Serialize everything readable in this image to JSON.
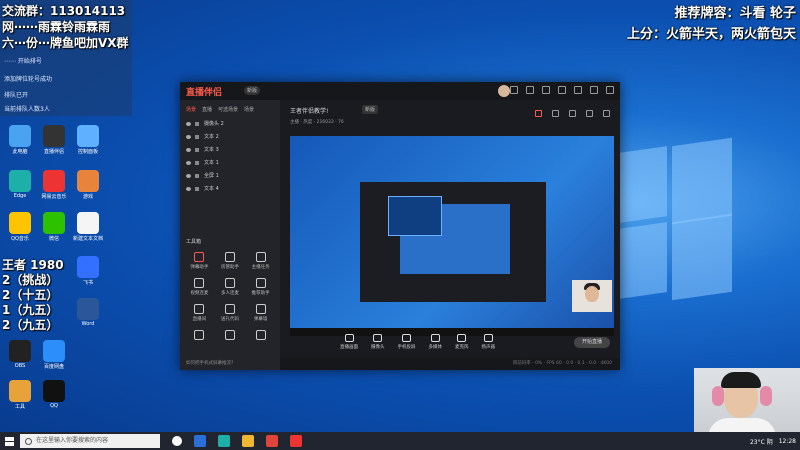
{
  "overlay_top_left": {
    "line1": "交流群：113014113",
    "line2": "网⋯⋯雨霖铃雨霖雨",
    "line3": "六⋯份⋯牌鱼吧加VX群",
    "chat": [
      "⋯⋯ 开始排号",
      "添加牌位轮号成功",
      "排队已开",
      "当前排队人数3人"
    ]
  },
  "overlay_top_right": {
    "line1": "推荐牌容：斗看 轮子",
    "line2": "上分：火箭半天，两火箭包天"
  },
  "stats_overlay": [
    "王者 1980",
    "2（挑战）",
    "2（十五）",
    "1（九五）",
    "2（九五）"
  ],
  "desktop_icons": [
    {
      "label": "此电脑",
      "color": "#4aa3f0"
    },
    {
      "label": "直播伴侣",
      "color": "#333"
    },
    {
      "label": "控制面板",
      "color": "#5fb0ff"
    },
    {
      "label": "Edge",
      "color": "#1db0a8"
    },
    {
      "label": "网易云音乐",
      "color": "#e33"
    },
    {
      "label": "游戏",
      "color": "#e7833a"
    },
    {
      "label": "QQ音乐",
      "color": "#ffc400"
    },
    {
      "label": "微信",
      "color": "#2dc100"
    },
    {
      "label": "新建文本文档",
      "color": "#f5f5f5"
    },
    {
      "label": "飞书",
      "color": "#3370ff"
    },
    {
      "label": "Word",
      "color": "#2b579a"
    },
    {
      "label": "OBS",
      "color": "#222"
    },
    {
      "label": "百度网盘",
      "color": "#2c8ef8"
    },
    {
      "label": "工具",
      "color": "#e7a23a"
    },
    {
      "label": "QQ",
      "color": "#111"
    }
  ],
  "app": {
    "logo": "直播伴侣",
    "version": "新版",
    "sidebar_tabs": [
      "场景",
      "直播",
      "可选场景",
      "场景"
    ],
    "scenes": [
      "摄像头 2",
      "文本 2",
      "文本 3",
      "文本 1",
      "全屏 1",
      "文本 4"
    ],
    "tools_title": "工具箱",
    "tools": [
      "弹幕助手",
      "房管助手",
      "主播任务",
      "视频连麦",
      "多人连麦",
      "推荐助手",
      "直播间",
      "送礼代码",
      "弹幕墙",
      "",
      "",
      ""
    ],
    "footer_note": "如何把手机式屏幕推流?",
    "main_title": "王者伴侣教学!",
    "main_tag": "新版",
    "main_sub": "主播 · 热度 · 216033 · 76",
    "controls": [
      "直播画面",
      "摄像头",
      "手机投屏",
      "多媒体",
      "麦克风",
      "扬声器"
    ],
    "go_live": "开始直播",
    "status_bar": "目前码率 · 0% · FPS 60 · 0.0 · 0.1 · 0.0 · 4K00"
  },
  "taskbar": {
    "search_placeholder": "在这里输入你要搜索的内容",
    "weather": "23°C 阴",
    "time": "12:28"
  }
}
